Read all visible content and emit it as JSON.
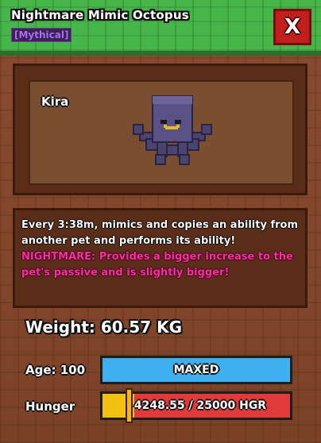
{
  "header": {
    "title": "Nightmare Mimic Octopus",
    "rarity": "[Mythical]",
    "close_label": "X"
  },
  "preview": {
    "pet_name": "Kira",
    "sprite": "purple-octopus-pet"
  },
  "description": {
    "main": "Every 3:38m, mimics and copies an ability from another pet and performs its ability!",
    "nightmare_label": "NIGHTMARE:",
    "nightmare_text": "Provides a bigger increase to the pet's passive and is slightly bigger!"
  },
  "stats": {
    "weight": "Weight: 60.57 KG",
    "age_label": "Age: 100",
    "age_status": "MAXED",
    "hunger_label": "Hunger",
    "hunger_value": "4248.55 / 25000 HGR",
    "hunger_fraction": 0.17
  },
  "colors": {
    "header_green": "#47b64a",
    "panel_brown": "#8a4c2f",
    "rarity_purple": "#b16cff",
    "nightmare_pink": "#ff2e9a",
    "age_bar_blue": "#3fb0ef",
    "hunger_bar_red": "#e23a3a",
    "hunger_fill_yellow": "#f2c011",
    "close_red": "#c21e1e"
  }
}
